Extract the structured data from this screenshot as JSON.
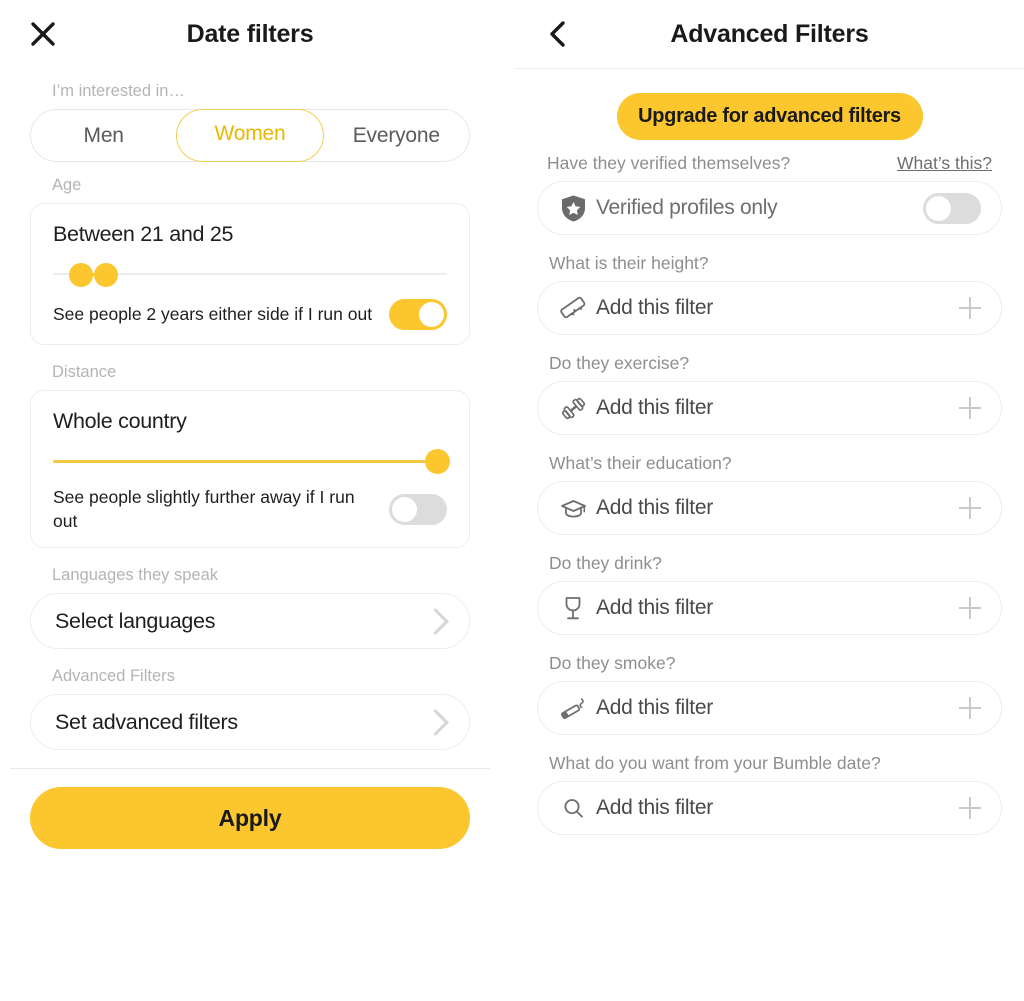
{
  "left": {
    "header": {
      "title": "Date filters",
      "close_icon": "close-icon"
    },
    "interested": {
      "label": "I’m interested in…",
      "options": [
        "Men",
        "Women",
        "Everyone"
      ],
      "selected": "Women"
    },
    "age": {
      "label": "Age",
      "value_text": "Between 21 and 25",
      "min": 21,
      "max": 25,
      "expand_text": "See people 2 years either side if I run out",
      "expand_on": true
    },
    "distance": {
      "label": "Distance",
      "value_text": "Whole country",
      "slider_percent": 100,
      "expand_text": "See people slightly further away if I run out",
      "expand_on": false
    },
    "languages": {
      "label": "Languages they speak",
      "value": "Select languages"
    },
    "advanced": {
      "label": "Advanced Filters",
      "value": "Set advanced filters"
    },
    "apply_label": "Apply"
  },
  "right": {
    "header": {
      "title": "Advanced Filters",
      "back_icon": "chevron-left-icon"
    },
    "upgrade_label": "Upgrade for advanced filters",
    "verified": {
      "question": "Have they verified themselves?",
      "link": "What’s this?",
      "row_label": "Verified profiles only",
      "icon": "shield-star-icon",
      "toggle_on": false
    },
    "filters": [
      {
        "question": "What is their height?",
        "action": "Add this filter",
        "icon": "ruler-icon"
      },
      {
        "question": "Do they exercise?",
        "action": "Add this filter",
        "icon": "dumbbell-icon"
      },
      {
        "question": "What’s their education?",
        "action": "Add this filter",
        "icon": "graduation-cap-icon"
      },
      {
        "question": "Do they drink?",
        "action": "Add this filter",
        "icon": "wine-glass-icon"
      },
      {
        "question": "Do they smoke?",
        "action": "Add this filter",
        "icon": "cigarette-icon"
      },
      {
        "question": "What do you want from your Bumble date?",
        "action": "Add this filter",
        "icon": "search-icon"
      }
    ]
  },
  "colors": {
    "accent": "#FBC62E",
    "accent_text": "#E8B800",
    "accent_border": "#F3CF52",
    "text_dark": "#1E1E1E",
    "text_muted": "#8E8E8E",
    "label_muted": "#B4B4B4",
    "border": "#EDEDED",
    "toggle_off": "#DCDCDC"
  }
}
